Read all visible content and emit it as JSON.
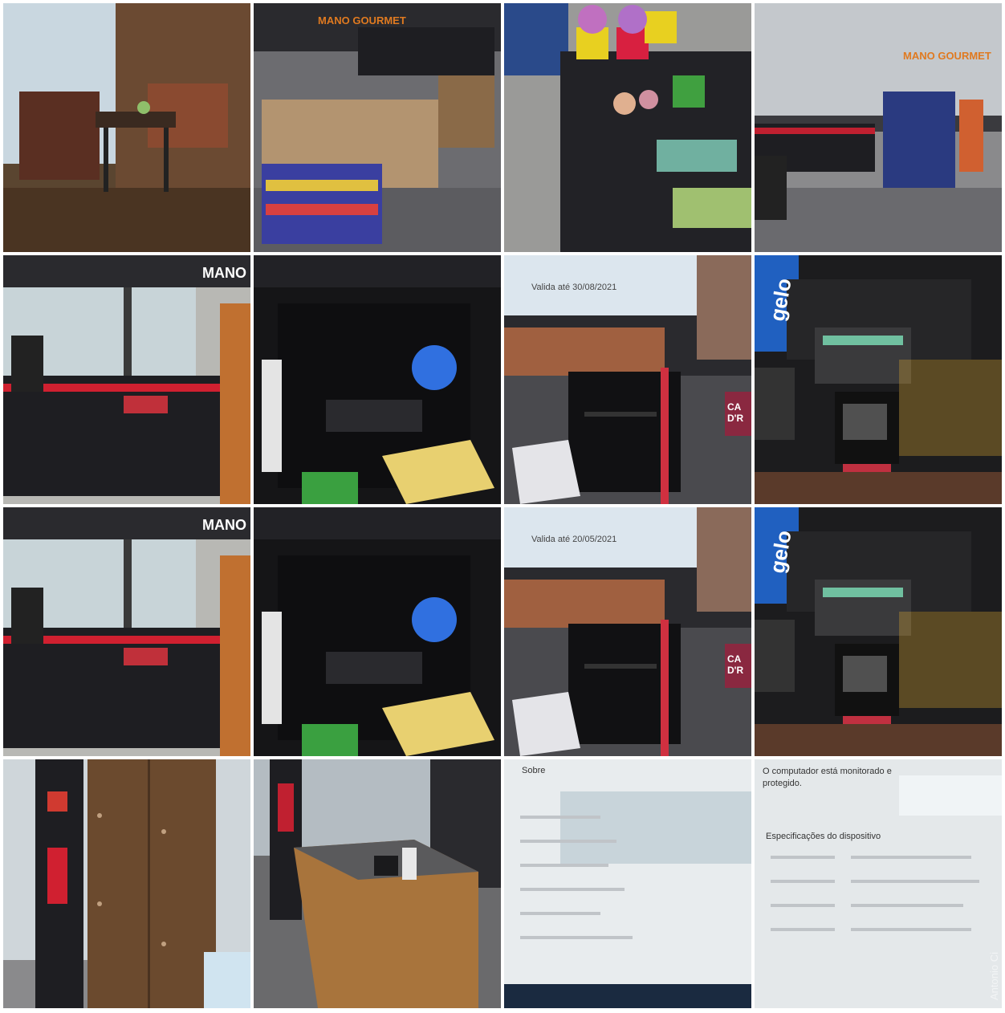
{
  "photos": [
    {
      "label": "Dining booth"
    },
    {
      "label": "Store shelves",
      "sign": "MANO GOURMET"
    },
    {
      "label": "Flower display"
    },
    {
      "label": "Checkout area",
      "sign": "MANO GOURMET"
    },
    {
      "label": "Checkout counter",
      "sign": "MANO"
    },
    {
      "label": "Cabinet cables"
    },
    {
      "label": "Receipt printer",
      "screen_text": "Valida até 30/08/2021",
      "side_sign": "CA D'R"
    },
    {
      "label": "Keyboard and scanner",
      "brand": "gelo"
    },
    {
      "label": "Checkout counter",
      "sign": "MANO"
    },
    {
      "label": "Cabinet cables"
    },
    {
      "label": "Receipt printer",
      "screen_text": "Valida até 20/05/2021",
      "side_sign": "CA D'R"
    },
    {
      "label": "Keyboard and scanner",
      "brand": "gelo"
    },
    {
      "label": "Wood cabinet"
    },
    {
      "label": "Wood counter"
    },
    {
      "label": "Device settings screen",
      "screen_heading": "Sobre"
    },
    {
      "label": "Device settings screen",
      "screen_heading": "O computador está monitorado e protegido.",
      "section": "Especificações do dispositivo"
    }
  ],
  "watermark": "Antonio Ci",
  "colors": {
    "accent": "#d81e2a",
    "wood": "#6b4a2e",
    "dark": "#1a1a1c"
  }
}
